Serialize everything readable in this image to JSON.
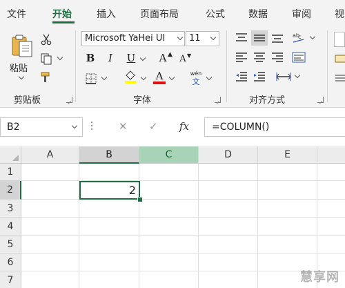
{
  "menu": {
    "tabs": [
      {
        "label": "文件"
      },
      {
        "label": "开始"
      },
      {
        "label": "插入"
      },
      {
        "label": "页面布局"
      },
      {
        "label": "公式"
      },
      {
        "label": "数据"
      },
      {
        "label": "审阅"
      },
      {
        "label": "视"
      }
    ],
    "active_tab": "开始"
  },
  "ribbon": {
    "clipboard": {
      "paste_label": "粘贴",
      "group_label": "剪贴板"
    },
    "font": {
      "font_name": "Microsoft YaHei UI",
      "font_size": "11",
      "group_label": "字体",
      "bold": "B",
      "italic": "I",
      "underline": "U",
      "grow": "A",
      "shrink": "A",
      "font_color_letter": "A",
      "phonetic_top": "wén",
      "phonetic_bottom": "文",
      "highlight_color": "#ffff00",
      "font_color": "#e01010"
    },
    "alignment": {
      "group_label": "对齐方式"
    }
  },
  "formula_bar": {
    "name_box": "B2",
    "cancel": "✕",
    "enter": "✓",
    "fx": "fx",
    "formula": "=COLUMN()"
  },
  "sheet": {
    "columns": [
      "A",
      "B",
      "C",
      "D",
      "E"
    ],
    "rows": [
      "1",
      "2",
      "3",
      "4",
      "5",
      "6",
      "7"
    ],
    "active_cell": "B2",
    "active_value": "2",
    "accent_color": "#1e6e42"
  },
  "watermark": "慧享网"
}
